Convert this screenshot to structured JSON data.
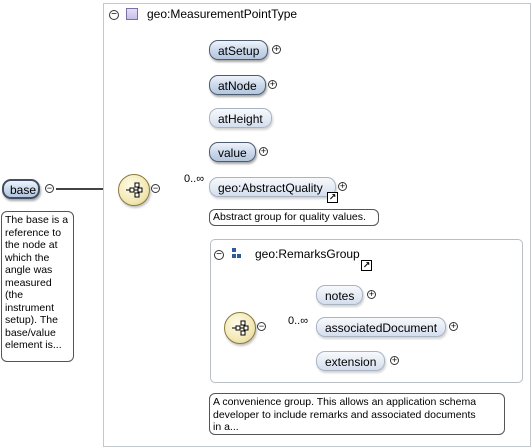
{
  "root": {
    "label": "base",
    "annotation_lines": [
      "The base is a",
      "reference to",
      "the node at",
      "which the",
      "angle was",
      "measured",
      "(the",
      "instrument",
      "setup). The",
      "base/value",
      "element is..."
    ]
  },
  "type_panel": {
    "title": "geo:MeasurementPointType"
  },
  "elements": {
    "atSetup": "atSetup",
    "atNode": "atNode",
    "atHeight": "atHeight",
    "value": "value",
    "abstractQuality": "geo:AbstractQuality",
    "abstractQuality_multiplicity": "0..∞",
    "abstractQuality_annotation": "Abstract group for quality values."
  },
  "remarks_group": {
    "title": "geo:RemarksGroup",
    "multiplicity": "0..∞",
    "items": {
      "notes": "notes",
      "associatedDocument": "associatedDocument",
      "extension": "extension"
    },
    "annotation_lines": [
      "A convenience group. This allows an application schema",
      "developer to include remarks and associated documents",
      "in a..."
    ]
  },
  "colors": {
    "pill_border": "#6f7e90",
    "pill_fill": "#c9d7ea",
    "sequence_fill": "#f4eaba",
    "panel_border": "#c3c8cc",
    "line": "#555555"
  }
}
